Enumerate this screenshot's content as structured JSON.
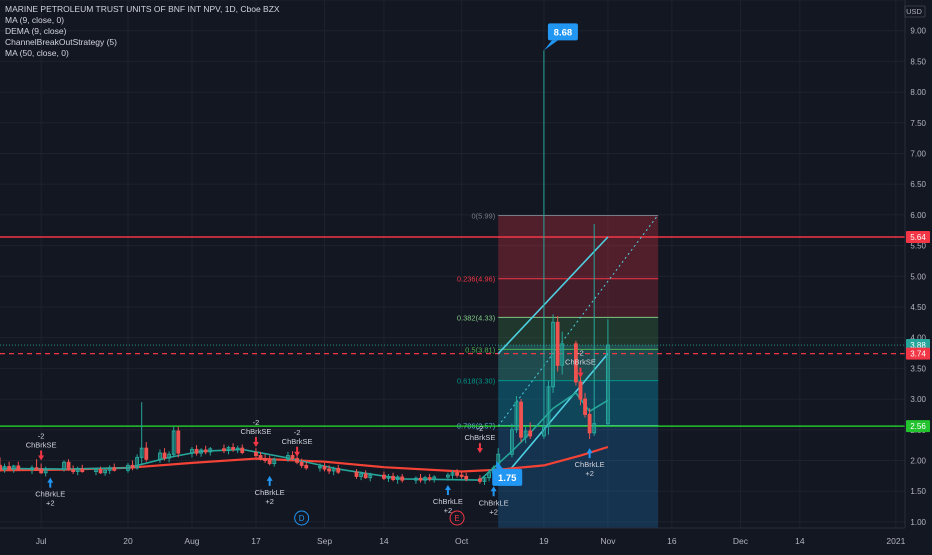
{
  "legend": {
    "title": "MARINE PETROLEUM TRUST UNITS OF BNF INT NPV, 1D, Cboe BZX",
    "indicators": [
      "MA (9, close, 0)",
      "DEMA (9, close)",
      "ChannelBreakOutStrategy (5)",
      "MA (50, close, 0)"
    ]
  },
  "currency": "USD",
  "colors": {
    "background": "#131722",
    "up": "#26a69a",
    "down": "#ef5350",
    "resistance": "#f23645",
    "support": "#22c32e",
    "ma50": "#f44336",
    "channel": "#4dd0e1",
    "label_blue": "#2196f3"
  },
  "chart_data": {
    "type": "candlestick",
    "y_axis": {
      "min": 0.9,
      "max": 9.5,
      "ticks": [
        "1.00",
        "1.50",
        "2.00",
        "2.50",
        "3.00",
        "3.50",
        "4.00",
        "4.50",
        "5.00",
        "5.50",
        "6.00",
        "6.50",
        "7.00",
        "7.50",
        "8.00",
        "8.50",
        "9.00",
        "9.50"
      ]
    },
    "x_axis": {
      "ticks": [
        {
          "label": "Jul",
          "x": "2020-07-01"
        },
        {
          "label": "20",
          "x": "2020-07-20"
        },
        {
          "label": "Aug",
          "x": "2020-08-03"
        },
        {
          "label": "17",
          "x": "2020-08-17"
        },
        {
          "label": "Sep",
          "x": "2020-09-01"
        },
        {
          "label": "14",
          "x": "2020-09-14"
        },
        {
          "label": "Oct",
          "x": "2020-10-01"
        },
        {
          "label": "19",
          "x": "2020-10-19"
        },
        {
          "label": "Nov",
          "x": "2020-11-02"
        },
        {
          "label": "16",
          "x": "2020-11-16"
        },
        {
          "label": "Dec",
          "x": "2020-12-01"
        },
        {
          "label": "14",
          "x": "2020-12-14"
        },
        {
          "label": "2021",
          "x": "2021-01-04"
        }
      ]
    },
    "price_lines": [
      {
        "name": "resistance",
        "value": 5.64,
        "style": "solid",
        "color": "#f23645",
        "label": "5.64"
      },
      {
        "name": "support",
        "value": 2.56,
        "style": "solid",
        "color": "#22c32e",
        "label": "2.56"
      },
      {
        "name": "mid-dashed",
        "value": 3.74,
        "style": "dashed",
        "color": "#f23645",
        "label": "3.74"
      }
    ],
    "last_price": {
      "value": 3.88,
      "label": "3.88"
    },
    "fibonacci": [
      {
        "ratio": "0",
        "value": 5.99,
        "label": "0(5.99)"
      },
      {
        "ratio": "0.236",
        "value": 4.96,
        "label": "0.236(4.96)"
      },
      {
        "ratio": "0.382",
        "value": 4.33,
        "label": "0.382(4.33)"
      },
      {
        "ratio": "0.5",
        "value": 3.81,
        "label": "0.5(3.81)"
      },
      {
        "ratio": "0.618",
        "value": 3.3,
        "label": "0.618(3.30)"
      },
      {
        "ratio": "0.786",
        "value": 2.57,
        "label": "0.786(2.57)"
      }
    ],
    "callouts": [
      {
        "text": "8.68",
        "value": 8.68,
        "x": "2020-10-19"
      },
      {
        "text": "1.75",
        "value": 1.75,
        "x": "2020-10-09"
      }
    ],
    "signals": [
      {
        "type": "short",
        "x": "2020-07-01",
        "value": 2.0,
        "lines": [
          "-2",
          "ChBrkSE"
        ]
      },
      {
        "type": "long",
        "x": "2020-07-03",
        "value": 1.72,
        "lines": [
          "ChBrkLE",
          "+2"
        ]
      },
      {
        "type": "short",
        "x": "2020-08-17",
        "value": 2.22,
        "lines": [
          "-2",
          "ChBrkSE"
        ]
      },
      {
        "type": "long",
        "x": "2020-08-20",
        "value": 1.75,
        "lines": [
          "ChBrkLE",
          "+2"
        ]
      },
      {
        "type": "short",
        "x": "2020-08-26",
        "value": 2.06,
        "lines": [
          "-2",
          "ChBrkSE"
        ]
      },
      {
        "type": "long",
        "x": "2020-09-28",
        "value": 1.6,
        "lines": [
          "ChBrkLE",
          "+2"
        ]
      },
      {
        "type": "short",
        "x": "2020-10-05",
        "value": 2.12,
        "lines": [
          "-2",
          "ChBrkSE"
        ]
      },
      {
        "type": "long",
        "x": "2020-10-08",
        "value": 1.58,
        "lines": [
          "ChBrkLE",
          "+2"
        ]
      },
      {
        "type": "short",
        "x": "2020-10-27",
        "value": 3.35,
        "lines": [
          "-2",
          "ChBrkSE"
        ]
      },
      {
        "type": "long",
        "x": "2020-10-29",
        "value": 2.2,
        "lines": [
          "ChBrkLE",
          "+2"
        ]
      }
    ],
    "events": [
      {
        "letter": "D",
        "x": "2020-08-27"
      },
      {
        "letter": "E",
        "x": "2020-09-30"
      }
    ],
    "candles": [
      {
        "x": "2020-06-22",
        "o": 1.92,
        "h": 2.05,
        "l": 1.82,
        "c": 1.85
      },
      {
        "x": "2020-06-23",
        "o": 1.85,
        "h": 1.95,
        "l": 1.8,
        "c": 1.9
      },
      {
        "x": "2020-06-24",
        "o": 1.9,
        "h": 1.98,
        "l": 1.84,
        "c": 1.86
      },
      {
        "x": "2020-06-25",
        "o": 1.86,
        "h": 1.93,
        "l": 1.8,
        "c": 1.91
      },
      {
        "x": "2020-06-26",
        "o": 1.91,
        "h": 1.98,
        "l": 1.83,
        "c": 1.85
      },
      {
        "x": "2020-06-29",
        "o": 1.85,
        "h": 1.92,
        "l": 1.78,
        "c": 1.88
      },
      {
        "x": "2020-06-30",
        "o": 1.88,
        "h": 2.02,
        "l": 1.83,
        "c": 1.86
      },
      {
        "x": "2020-07-01",
        "o": 1.86,
        "h": 1.95,
        "l": 1.78,
        "c": 1.8
      },
      {
        "x": "2020-07-02",
        "o": 1.8,
        "h": 1.9,
        "l": 1.74,
        "c": 1.86
      },
      {
        "x": "2020-07-06",
        "o": 1.86,
        "h": 2.0,
        "l": 1.82,
        "c": 1.97
      },
      {
        "x": "2020-07-07",
        "o": 1.97,
        "h": 2.02,
        "l": 1.83,
        "c": 1.85
      },
      {
        "x": "2020-07-08",
        "o": 1.85,
        "h": 1.92,
        "l": 1.78,
        "c": 1.82
      },
      {
        "x": "2020-07-09",
        "o": 1.82,
        "h": 1.9,
        "l": 1.76,
        "c": 1.86
      },
      {
        "x": "2020-07-10",
        "o": 1.86,
        "h": 1.93,
        "l": 1.8,
        "c": 1.82
      },
      {
        "x": "2020-07-13",
        "o": 1.82,
        "h": 1.88,
        "l": 1.76,
        "c": 1.85
      },
      {
        "x": "2020-07-14",
        "o": 1.85,
        "h": 1.9,
        "l": 1.78,
        "c": 1.8
      },
      {
        "x": "2020-07-15",
        "o": 1.8,
        "h": 1.88,
        "l": 1.75,
        "c": 1.84
      },
      {
        "x": "2020-07-16",
        "o": 1.84,
        "h": 1.92,
        "l": 1.78,
        "c": 1.88
      },
      {
        "x": "2020-07-17",
        "o": 1.88,
        "h": 1.95,
        "l": 1.82,
        "c": 1.84
      },
      {
        "x": "2020-07-20",
        "o": 1.84,
        "h": 1.96,
        "l": 1.8,
        "c": 1.92
      },
      {
        "x": "2020-07-21",
        "o": 1.92,
        "h": 2.0,
        "l": 1.84,
        "c": 1.88
      },
      {
        "x": "2020-07-22",
        "o": 1.88,
        "h": 2.1,
        "l": 1.85,
        "c": 2.05
      },
      {
        "x": "2020-07-23",
        "o": 2.05,
        "h": 2.95,
        "l": 1.95,
        "c": 2.2
      },
      {
        "x": "2020-07-24",
        "o": 2.2,
        "h": 2.3,
        "l": 1.98,
        "c": 2.02
      },
      {
        "x": "2020-07-27",
        "o": 2.02,
        "h": 2.18,
        "l": 1.96,
        "c": 2.12
      },
      {
        "x": "2020-07-28",
        "o": 2.12,
        "h": 2.2,
        "l": 2.0,
        "c": 2.04
      },
      {
        "x": "2020-07-29",
        "o": 2.04,
        "h": 2.15,
        "l": 1.97,
        "c": 2.1
      },
      {
        "x": "2020-07-30",
        "o": 2.1,
        "h": 2.55,
        "l": 2.05,
        "c": 2.48
      },
      {
        "x": "2020-07-31",
        "o": 2.48,
        "h": 2.55,
        "l": 2.05,
        "c": 2.12
      },
      {
        "x": "2020-08-03",
        "o": 2.12,
        "h": 2.22,
        "l": 2.05,
        "c": 2.18
      },
      {
        "x": "2020-08-04",
        "o": 2.18,
        "h": 2.25,
        "l": 2.08,
        "c": 2.12
      },
      {
        "x": "2020-08-05",
        "o": 2.12,
        "h": 2.2,
        "l": 2.06,
        "c": 2.17
      },
      {
        "x": "2020-08-06",
        "o": 2.17,
        "h": 2.24,
        "l": 2.1,
        "c": 2.14
      },
      {
        "x": "2020-08-07",
        "o": 2.14,
        "h": 2.22,
        "l": 2.08,
        "c": 2.19
      },
      {
        "x": "2020-08-10",
        "o": 2.19,
        "h": 2.26,
        "l": 2.12,
        "c": 2.16
      },
      {
        "x": "2020-08-11",
        "o": 2.16,
        "h": 2.24,
        "l": 2.1,
        "c": 2.21
      },
      {
        "x": "2020-08-12",
        "o": 2.21,
        "h": 2.28,
        "l": 2.14,
        "c": 2.18
      },
      {
        "x": "2020-08-13",
        "o": 2.18,
        "h": 2.24,
        "l": 2.12,
        "c": 2.2
      },
      {
        "x": "2020-08-14",
        "o": 2.2,
        "h": 2.26,
        "l": 2.1,
        "c": 2.13
      },
      {
        "x": "2020-08-17",
        "o": 2.13,
        "h": 2.2,
        "l": 2.05,
        "c": 2.08
      },
      {
        "x": "2020-08-18",
        "o": 2.08,
        "h": 2.14,
        "l": 2.0,
        "c": 2.03
      },
      {
        "x": "2020-08-19",
        "o": 2.03,
        "h": 2.1,
        "l": 1.96,
        "c": 2.0
      },
      {
        "x": "2020-08-20",
        "o": 2.0,
        "h": 2.08,
        "l": 1.92,
        "c": 1.95
      },
      {
        "x": "2020-08-21",
        "o": 1.95,
        "h": 2.05,
        "l": 1.9,
        "c": 2.02
      },
      {
        "x": "2020-08-24",
        "o": 2.02,
        "h": 2.14,
        "l": 1.98,
        "c": 2.08
      },
      {
        "x": "2020-08-25",
        "o": 2.08,
        "h": 2.15,
        "l": 2.0,
        "c": 2.03
      },
      {
        "x": "2020-08-26",
        "o": 2.03,
        "h": 2.08,
        "l": 1.94,
        "c": 1.97
      },
      {
        "x": "2020-08-27",
        "o": 1.97,
        "h": 2.03,
        "l": 1.88,
        "c": 1.92
      },
      {
        "x": "2020-08-28",
        "o": 1.92,
        "h": 1.98,
        "l": 1.85,
        "c": 1.88
      },
      {
        "x": "2020-08-31",
        "o": 1.88,
        "h": 1.95,
        "l": 1.82,
        "c": 1.9
      },
      {
        "x": "2020-09-01",
        "o": 1.9,
        "h": 1.96,
        "l": 1.82,
        "c": 1.86
      },
      {
        "x": "2020-09-02",
        "o": 1.86,
        "h": 1.92,
        "l": 1.78,
        "c": 1.83
      },
      {
        "x": "2020-09-03",
        "o": 1.83,
        "h": 1.9,
        "l": 1.76,
        "c": 1.87
      },
      {
        "x": "2020-09-04",
        "o": 1.87,
        "h": 1.93,
        "l": 1.78,
        "c": 1.81
      },
      {
        "x": "2020-09-08",
        "o": 1.81,
        "h": 1.86,
        "l": 1.7,
        "c": 1.74
      },
      {
        "x": "2020-09-09",
        "o": 1.74,
        "h": 1.82,
        "l": 1.68,
        "c": 1.78
      },
      {
        "x": "2020-09-10",
        "o": 1.78,
        "h": 1.84,
        "l": 1.7,
        "c": 1.72
      },
      {
        "x": "2020-09-11",
        "o": 1.72,
        "h": 1.8,
        "l": 1.66,
        "c": 1.76
      },
      {
        "x": "2020-09-14",
        "o": 1.76,
        "h": 1.82,
        "l": 1.68,
        "c": 1.71
      },
      {
        "x": "2020-09-15",
        "o": 1.71,
        "h": 1.78,
        "l": 1.65,
        "c": 1.74
      },
      {
        "x": "2020-09-16",
        "o": 1.74,
        "h": 1.8,
        "l": 1.66,
        "c": 1.69
      },
      {
        "x": "2020-09-17",
        "o": 1.69,
        "h": 1.76,
        "l": 1.62,
        "c": 1.73
      },
      {
        "x": "2020-09-18",
        "o": 1.73,
        "h": 1.78,
        "l": 1.64,
        "c": 1.68
      },
      {
        "x": "2020-09-21",
        "o": 1.68,
        "h": 1.74,
        "l": 1.62,
        "c": 1.71
      },
      {
        "x": "2020-09-22",
        "o": 1.71,
        "h": 1.78,
        "l": 1.64,
        "c": 1.68
      },
      {
        "x": "2020-09-23",
        "o": 1.68,
        "h": 1.75,
        "l": 1.62,
        "c": 1.72
      },
      {
        "x": "2020-09-24",
        "o": 1.72,
        "h": 1.78,
        "l": 1.66,
        "c": 1.7
      },
      {
        "x": "2020-09-25",
        "o": 1.7,
        "h": 1.76,
        "l": 1.64,
        "c": 1.73
      },
      {
        "x": "2020-09-28",
        "o": 1.73,
        "h": 1.8,
        "l": 1.67,
        "c": 1.76
      },
      {
        "x": "2020-09-29",
        "o": 1.76,
        "h": 1.84,
        "l": 1.7,
        "c": 1.8
      },
      {
        "x": "2020-09-30",
        "o": 1.8,
        "h": 1.86,
        "l": 1.72,
        "c": 1.76
      },
      {
        "x": "2020-10-01",
        "o": 1.76,
        "h": 1.82,
        "l": 1.7,
        "c": 1.74
      },
      {
        "x": "2020-10-02",
        "o": 1.74,
        "h": 1.8,
        "l": 1.66,
        "c": 1.7
      },
      {
        "x": "2020-10-05",
        "o": 1.7,
        "h": 1.76,
        "l": 1.62,
        "c": 1.66
      },
      {
        "x": "2020-10-06",
        "o": 1.66,
        "h": 1.74,
        "l": 1.6,
        "c": 1.72
      },
      {
        "x": "2020-10-07",
        "o": 1.72,
        "h": 1.85,
        "l": 1.66,
        "c": 1.8
      },
      {
        "x": "2020-10-08",
        "o": 1.8,
        "h": 1.92,
        "l": 1.74,
        "c": 1.88
      },
      {
        "x": "2020-10-09",
        "o": 1.88,
        "h": 2.2,
        "l": 1.82,
        "c": 2.1
      },
      {
        "x": "2020-10-12",
        "o": 2.1,
        "h": 2.6,
        "l": 2.05,
        "c": 2.5
      },
      {
        "x": "2020-10-13",
        "o": 2.5,
        "h": 3.05,
        "l": 2.45,
        "c": 2.95
      },
      {
        "x": "2020-10-14",
        "o": 2.95,
        "h": 3.0,
        "l": 2.3,
        "c": 2.38
      },
      {
        "x": "2020-10-15",
        "o": 2.38,
        "h": 2.55,
        "l": 2.28,
        "c": 2.48
      },
      {
        "x": "2020-10-16",
        "o": 2.48,
        "h": 2.62,
        "l": 2.35,
        "c": 2.4
      },
      {
        "x": "2020-10-19",
        "o": 2.4,
        "h": 8.68,
        "l": 2.35,
        "c": 2.55
      },
      {
        "x": "2020-10-20",
        "o": 2.55,
        "h": 3.3,
        "l": 2.42,
        "c": 3.2
      },
      {
        "x": "2020-10-21",
        "o": 3.2,
        "h": 4.38,
        "l": 3.1,
        "c": 4.25
      },
      {
        "x": "2020-10-22",
        "o": 4.25,
        "h": 4.35,
        "l": 3.45,
        "c": 3.55
      },
      {
        "x": "2020-10-23",
        "o": 3.55,
        "h": 4.1,
        "l": 3.4,
        "c": 3.9
      },
      {
        "x": "2020-10-26",
        "o": 3.9,
        "h": 3.95,
        "l": 3.22,
        "c": 3.28
      },
      {
        "x": "2020-10-27",
        "o": 3.28,
        "h": 3.45,
        "l": 2.9,
        "c": 3.0
      },
      {
        "x": "2020-10-28",
        "o": 3.0,
        "h": 3.1,
        "l": 2.7,
        "c": 2.75
      },
      {
        "x": "2020-10-29",
        "o": 2.75,
        "h": 2.85,
        "l": 2.35,
        "c": 2.45
      },
      {
        "x": "2020-10-30",
        "o": 2.45,
        "h": 5.85,
        "l": 2.4,
        "c": 2.6
      },
      {
        "x": "2020-11-02",
        "o": 2.6,
        "h": 4.3,
        "l": 2.55,
        "c": 3.88
      }
    ],
    "series": [
      {
        "name": "MA (50, close, 0)",
        "color": "#f44336",
        "points": [
          [
            "2020-06-22",
            1.84
          ],
          [
            "2020-07-06",
            1.85
          ],
          [
            "2020-07-20",
            1.88
          ],
          [
            "2020-08-03",
            1.96
          ],
          [
            "2020-08-17",
            2.03
          ],
          [
            "2020-09-01",
            1.98
          ],
          [
            "2020-09-14",
            1.89
          ],
          [
            "2020-10-01",
            1.82
          ],
          [
            "2020-10-09",
            1.85
          ],
          [
            "2020-10-19",
            1.92
          ],
          [
            "2020-10-27",
            2.08
          ],
          [
            "2020-11-02",
            2.22
          ]
        ]
      },
      {
        "name": "DEMA (9, close)",
        "color": "#26a69a",
        "points": [
          [
            "2020-06-22",
            1.87
          ],
          [
            "2020-07-06",
            1.86
          ],
          [
            "2020-07-20",
            1.88
          ],
          [
            "2020-07-29",
            2.05
          ],
          [
            "2020-08-05",
            2.15
          ],
          [
            "2020-08-14",
            2.18
          ],
          [
            "2020-08-24",
            2.04
          ],
          [
            "2020-09-04",
            1.86
          ],
          [
            "2020-09-18",
            1.7
          ],
          [
            "2020-10-05",
            1.68
          ],
          [
            "2020-10-12",
            2.15
          ],
          [
            "2020-10-16",
            2.45
          ],
          [
            "2020-10-21",
            2.85
          ],
          [
            "2020-10-26",
            3.1
          ],
          [
            "2020-10-29",
            2.8
          ],
          [
            "2020-11-02",
            2.98
          ]
        ]
      }
    ],
    "channel_lines": [
      {
        "from": [
          "2020-10-09",
          3.74
        ],
        "to": [
          "2020-11-02",
          5.64
        ],
        "style": "solid"
      },
      {
        "from": [
          "2020-10-09",
          1.62
        ],
        "to": [
          "2020-11-02",
          3.74
        ],
        "style": "solid"
      },
      {
        "from": [
          "2020-10-09",
          2.56
        ],
        "to": [
          "2020-11-13",
          6.0
        ],
        "style": "dotted"
      }
    ],
    "fib_box": {
      "x_start": "2020-10-09",
      "x_end": "2020-11-13"
    },
    "projection_box": {
      "x_start": "2020-10-09",
      "x_end": "2020-11-13",
      "top": 3.88,
      "bottom": 0.9
    }
  }
}
